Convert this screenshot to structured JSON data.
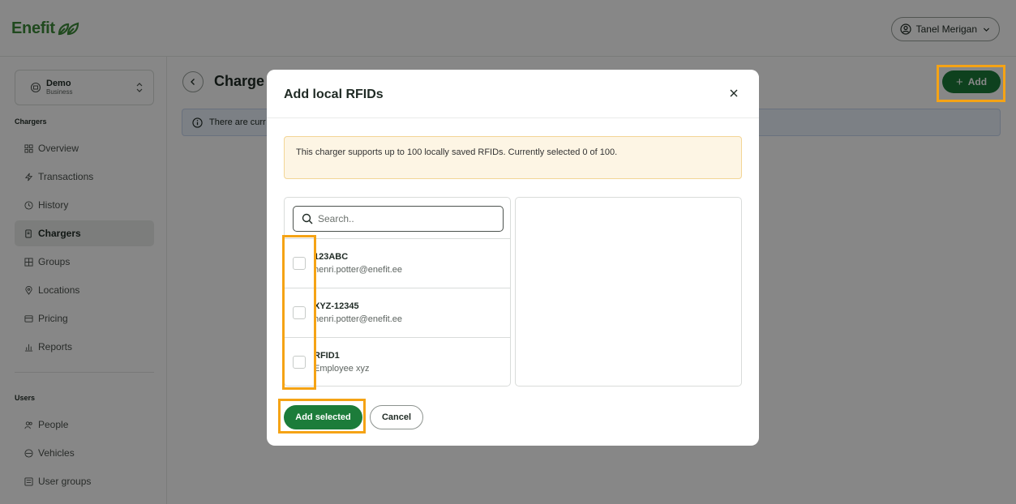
{
  "app": {
    "logo_text": "Enefit"
  },
  "topbar": {
    "user_name": "Tanel Merigan"
  },
  "org_switcher": {
    "name": "Demo",
    "type": "Business"
  },
  "sidebar": {
    "chargers_section": "Chargers",
    "chargers_items": [
      {
        "label": "Overview",
        "icon": "grid-icon"
      },
      {
        "label": "Transactions",
        "icon": "bolt-icon"
      },
      {
        "label": "History",
        "icon": "clock-icon"
      },
      {
        "label": "Chargers",
        "icon": "charger-icon",
        "active": true
      },
      {
        "label": "Groups",
        "icon": "groups-icon"
      },
      {
        "label": "Locations",
        "icon": "pin-icon"
      },
      {
        "label": "Pricing",
        "icon": "pricing-icon"
      },
      {
        "label": "Reports",
        "icon": "chart-icon"
      }
    ],
    "users_section": "Users",
    "users_items": [
      {
        "label": "People",
        "icon": "people-icon"
      },
      {
        "label": "Vehicles",
        "icon": "car-icon"
      },
      {
        "label": "User groups",
        "icon": "usergroups-icon"
      }
    ]
  },
  "main": {
    "title": "Charge",
    "add_label": "Add",
    "info_text": "There are curr"
  },
  "modal": {
    "title": "Add local RFIDs",
    "warning": "This charger supports up to 100 locally saved RFIDs. Currently selected 0 of 100.",
    "search_placeholder": "Search..",
    "rfids": [
      {
        "title": "123ABC",
        "subtitle": "henri.potter@enefit.ee",
        "checked": false
      },
      {
        "title": "XYZ-12345",
        "subtitle": "henri.potter@enefit.ee",
        "checked": false
      },
      {
        "title": "RFID1",
        "subtitle": "Employee xyz",
        "checked": false
      }
    ],
    "primary_button": "Add selected",
    "secondary_button": "Cancel"
  },
  "colors": {
    "brand_green": "#1c7c3a",
    "logo_green": "#3d8b3a",
    "highlight": "#f5a315",
    "warning_bg": "#fdf5e4",
    "info_bg": "#eaf1fb"
  }
}
